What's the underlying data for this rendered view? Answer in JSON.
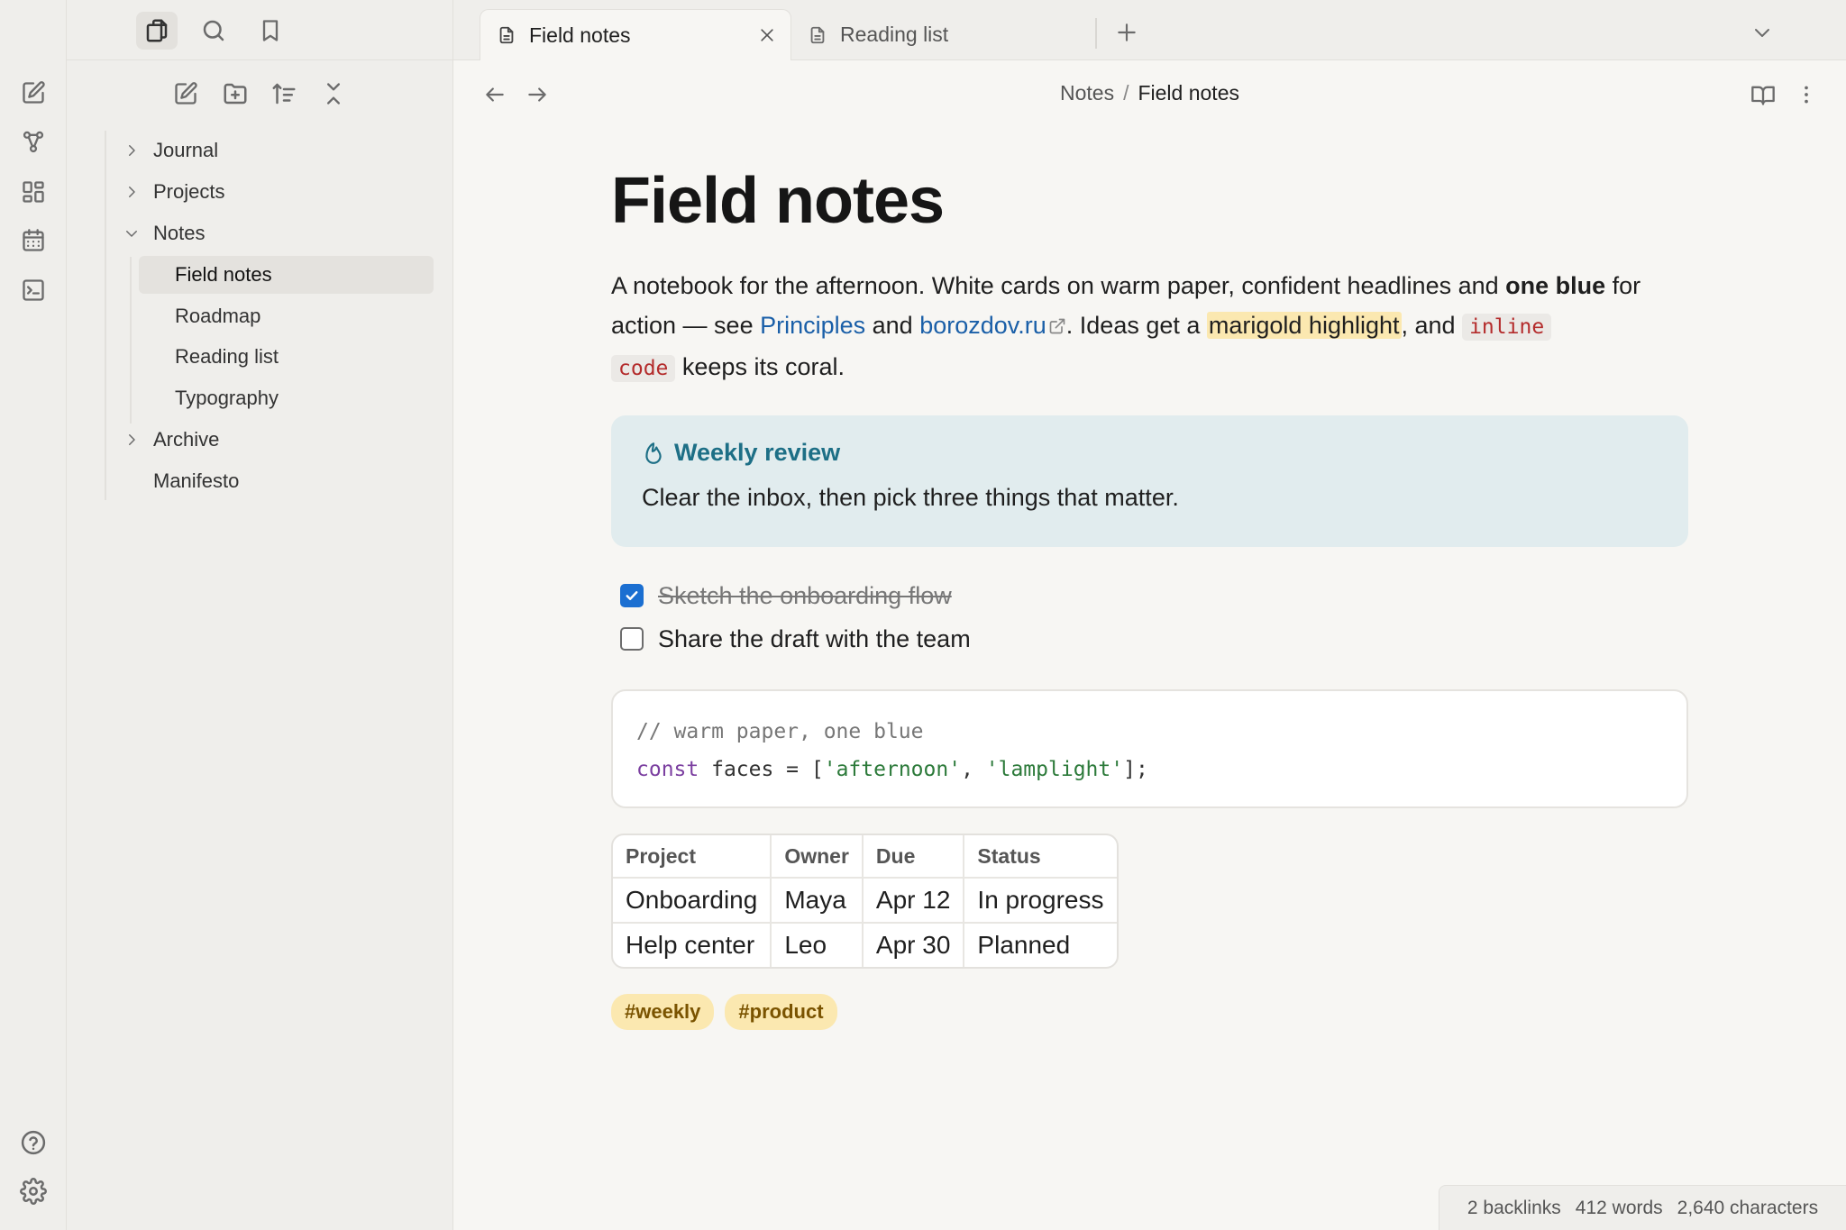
{
  "tabs": [
    {
      "label": "Field notes",
      "active": true
    },
    {
      "label": "Reading list",
      "active": false
    }
  ],
  "sidebar": {
    "tree": [
      {
        "label": "Journal",
        "expanded": false
      },
      {
        "label": "Projects",
        "expanded": false
      },
      {
        "label": "Notes",
        "expanded": true,
        "children": [
          {
            "label": "Field notes",
            "active": true
          },
          {
            "label": "Roadmap"
          },
          {
            "label": "Reading list"
          },
          {
            "label": "Typography"
          }
        ]
      },
      {
        "label": "Archive",
        "expanded": false
      },
      {
        "label": "Manifesto"
      }
    ]
  },
  "breadcrumb": {
    "parent": "Notes",
    "separator": "/",
    "current": "Field notes"
  },
  "document": {
    "title": "Field notes",
    "intro": {
      "t1": "A notebook for the afternoon. White cards on warm paper, confident headlines and ",
      "bold": "one blue",
      "t2": " for action — see ",
      "link1": "Principles",
      "t3": " and ",
      "link2": "borozdov.ru",
      "t4": ". Ideas get a ",
      "highlight": "marigold highlight",
      "t5": ", and ",
      "code1": "inline",
      "t6": " ",
      "code2": "code",
      "t7": " keeps its coral."
    },
    "callout": {
      "title": "Weekly review",
      "body": "Clear the inbox, then pick three things that matter."
    },
    "tasks": [
      {
        "text": "Sketch the onboarding flow",
        "done": true
      },
      {
        "text": "Share the draft with the team",
        "done": false
      }
    ],
    "code": {
      "comment": "// warm paper, one blue",
      "kw": "const",
      "mid": " faces = [",
      "s1": "'afternoon'",
      "comma": ", ",
      "s2": "'lamplight'",
      "end": "];"
    },
    "table": {
      "headers": [
        "Project",
        "Owner",
        "Due",
        "Status"
      ],
      "rows": [
        [
          "Onboarding",
          "Maya",
          "Apr 12",
          "In progress"
        ],
        [
          "Help center",
          "Leo",
          "Apr 30",
          "Planned"
        ]
      ]
    },
    "tags": [
      "#weekly",
      "#product"
    ]
  },
  "status": {
    "backlinks": "2 backlinks",
    "words": "412 words",
    "characters": "2,640 characters"
  },
  "colors": {
    "accent": "#1b6fd1",
    "link": "#1a5fa8",
    "highlight": "#fbe8b0",
    "callout_bg": "#e1ecee",
    "callout_title": "#1d6f86",
    "code_inline": "#b42c2c"
  },
  "icons": [
    "new-note-icon",
    "graph-icon",
    "canvas-icon",
    "calendar-icon",
    "terminal-icon",
    "help-icon",
    "settings-icon",
    "files-icon",
    "search-icon",
    "bookmark-icon",
    "new-folder-icon",
    "sort-icon",
    "collapse-icon",
    "document-icon",
    "close-icon",
    "plus-icon",
    "chevron-down-icon",
    "back-arrow-icon",
    "forward-arrow-icon",
    "reading-view-icon",
    "more-options-icon",
    "flame-icon",
    "external-link-icon"
  ]
}
